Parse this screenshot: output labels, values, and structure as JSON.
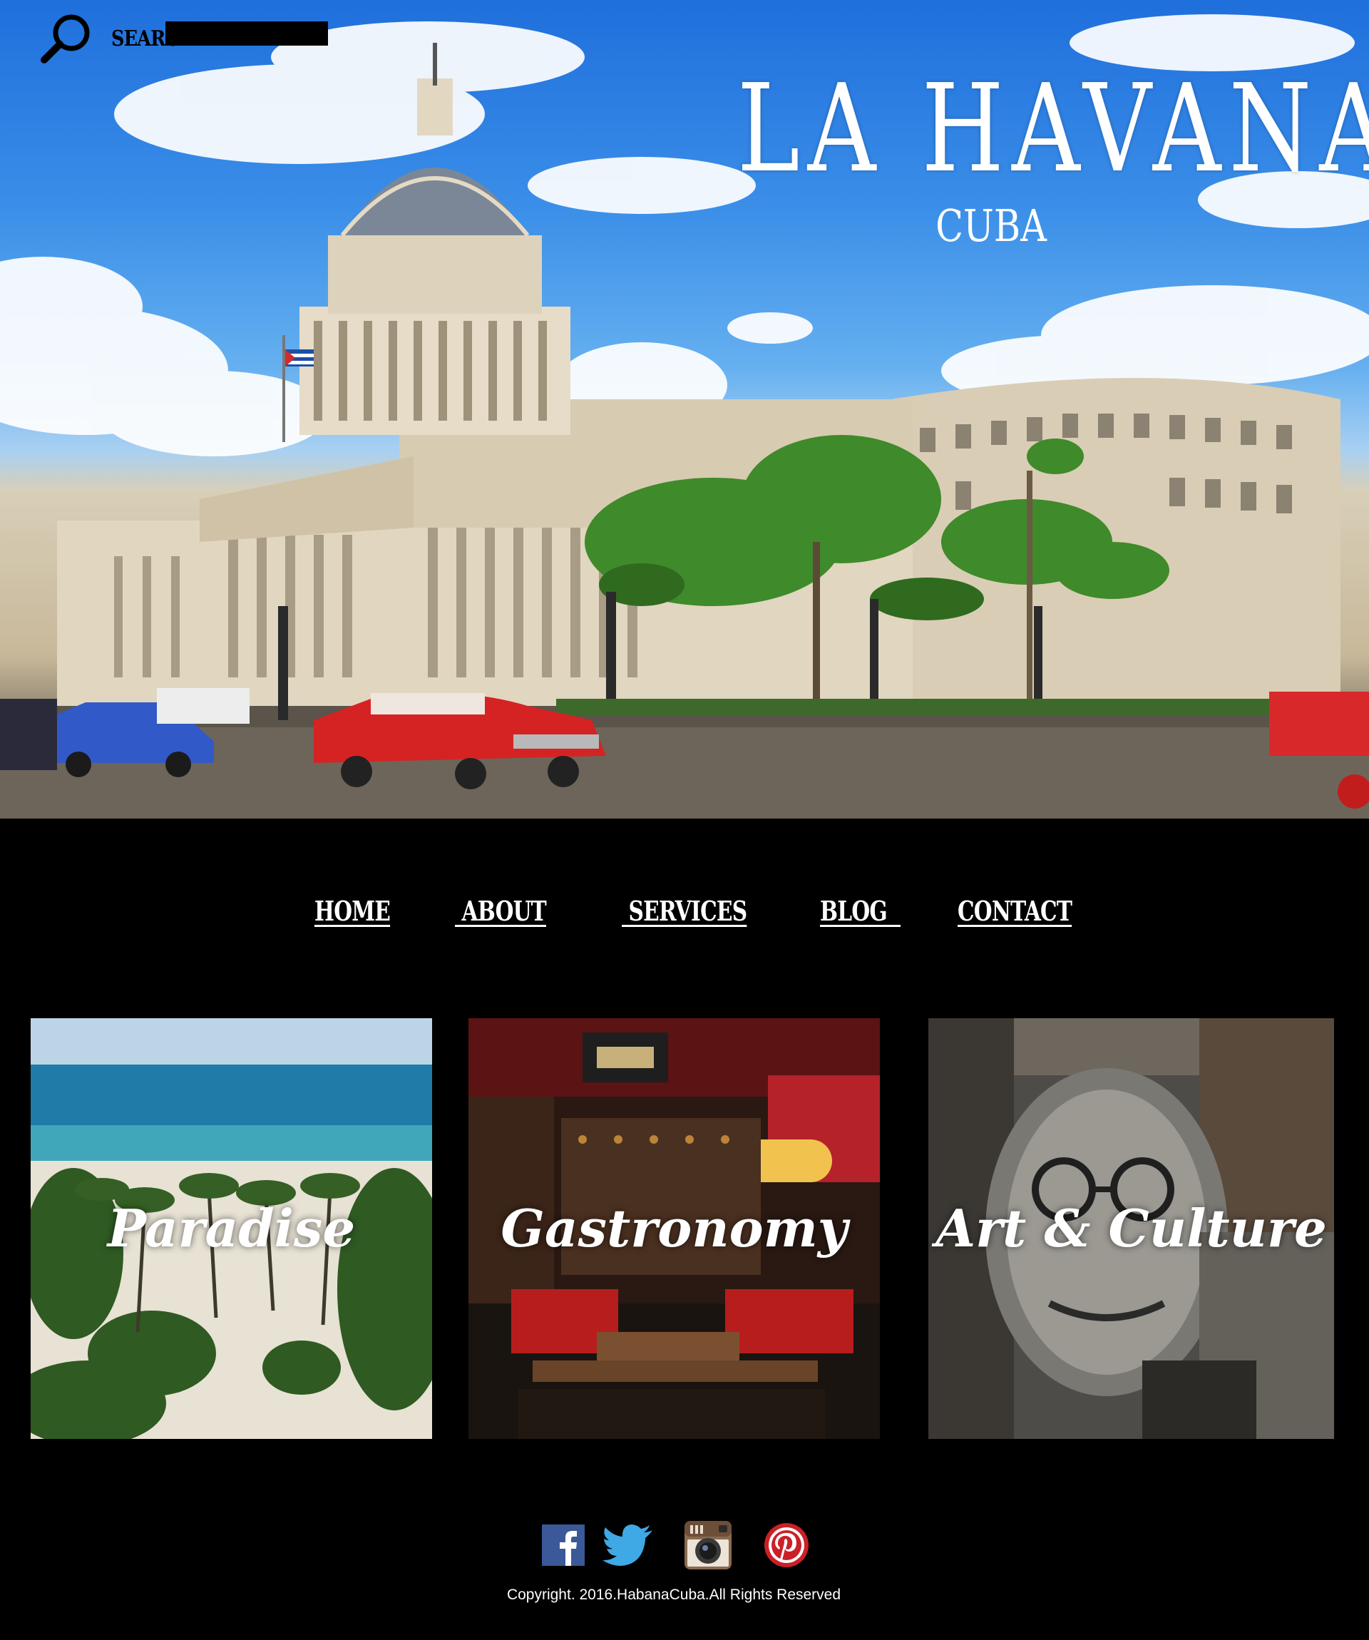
{
  "header": {
    "search_label": "SEARCH",
    "search_value": "",
    "title": "LA HAVANA",
    "subtitle": "CUBA"
  },
  "nav": [
    {
      "label": "HOME"
    },
    {
      "label": " ABOUT"
    },
    {
      "label": " SERVICES"
    },
    {
      "label": "BLOG  "
    },
    {
      "label": "CONTACT"
    }
  ],
  "cards": [
    {
      "label": "Paradise"
    },
    {
      "label": "Gastronomy"
    },
    {
      "label": "Art & Culture"
    }
  ],
  "social": [
    {
      "icon": "facebook-icon",
      "color": "#3b5998"
    },
    {
      "icon": "twitter-icon",
      "color": "#3fa9e6"
    },
    {
      "icon": "instagram-icon",
      "color": "#8a6a4f"
    },
    {
      "icon": "pinterest-icon",
      "color": "#cb2027"
    }
  ],
  "footer": {
    "copyright": "Copyright. 2016.HabanaCuba.All Rights Reserved"
  }
}
